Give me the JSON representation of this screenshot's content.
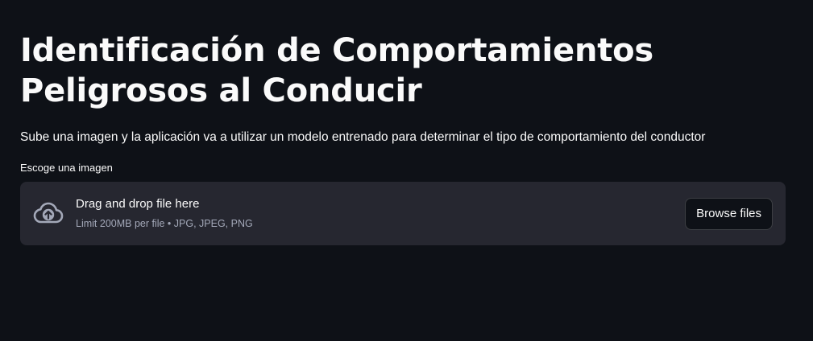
{
  "header": {
    "title": "Identificación de Comportamientos Peligrosos al Conducir",
    "subtitle": "Sube una imagen y la aplicación va a utilizar un modelo entrenado para determinar el tipo de comportamiento del conductor"
  },
  "uploader": {
    "label": "Escoge una imagen",
    "drag_text": "Drag and drop file here",
    "limit_text": "Limit 200MB per file • JPG, JPEG, PNG",
    "browse_label": "Browse files",
    "icon": "cloud-upload-icon"
  },
  "colors": {
    "background": "#0e1117",
    "dropzone": "#262730",
    "text": "#fafafa",
    "muted_text": "#a3a8b8"
  }
}
